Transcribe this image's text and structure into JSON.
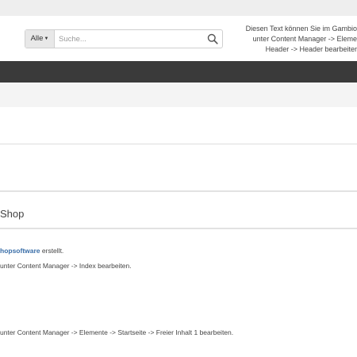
{
  "header": {
    "search": {
      "category_label": "Alle",
      "placeholder": "Suche..."
    },
    "note_lines": [
      "Diesen Text können Sie im Gambio",
      "unter Content Manager -> Eleme",
      "Header -> Header bearbeiter"
    ]
  },
  "main": {
    "section_title": "Shop",
    "paragraph1": {
      "link_text": "hopsoftware",
      "suffix": " erstellt."
    },
    "paragraph2": "unter Content Manager -> Index bearbeiten.",
    "paragraph3": "unter Content Manager -> Elemente -> Startseite -> Freier Inhalt 1 bearbeiten."
  },
  "colors": {
    "topbar": "#eeeeee",
    "navbar": "#3a3a3a",
    "link": "#3a6ea8"
  },
  "icons": [
    "search-icon",
    "caret-down-icon"
  ]
}
